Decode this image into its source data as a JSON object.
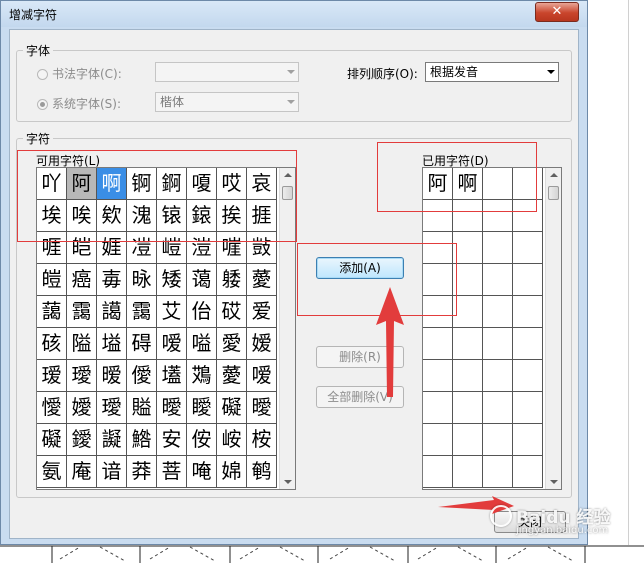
{
  "dialog": {
    "title": "增减字符",
    "close_label": "✕"
  },
  "font_group": {
    "label": "字体",
    "calligraphy_radio": "书法字体(C):",
    "system_radio": "系统字体(S):",
    "calligraphy_value": "",
    "system_value": "楷体",
    "sort_label": "排列顺序(O):",
    "sort_value": "根据发音"
  },
  "char_group": {
    "label": "字符",
    "available_label": "可用字符(L)",
    "used_label": "已用字符(D)",
    "available_chars": [
      [
        "吖",
        "阿",
        "啊",
        "锕",
        "錒",
        "嗄",
        "哎",
        "哀"
      ],
      [
        "埃",
        "唉",
        "欸",
        "溾",
        "锿",
        "鎄",
        "挨",
        "捱"
      ],
      [
        "啀",
        "皑",
        "娾",
        "凒",
        "嵦",
        "溰",
        "嘊",
        "敱"
      ],
      [
        "皚",
        "癌",
        "毐",
        "昹",
        "矮",
        "蔼",
        "躷",
        "薆"
      ],
      [
        "藹",
        "靄",
        "譪",
        "靄",
        "艾",
        "佁",
        "砹",
        "爱"
      ],
      [
        "硋",
        "隘",
        "塧",
        "碍",
        "嗳",
        "嗌",
        "愛",
        "嫒"
      ],
      [
        "瑷",
        "璦",
        "暧",
        "僾",
        "壒",
        "鴱",
        "薆",
        "嗳"
      ],
      [
        "懓",
        "嬡",
        "璦",
        "賹",
        "曖",
        "瞹",
        "礙",
        "曖"
      ],
      [
        "礙",
        "鑀",
        "譺",
        "鯦",
        "安",
        "侒",
        "峖",
        "桉"
      ],
      [
        "氨",
        "庵",
        "谙",
        "莽",
        "菩",
        "唵",
        "婂",
        "鹌"
      ]
    ],
    "selected_gray": [
      0,
      1
    ],
    "selected_blue": [
      0,
      2
    ],
    "used_chars": [
      "阿",
      "啊"
    ],
    "add_button": "添加(A)",
    "delete_button": "删除(R)",
    "delete_all_button": "全部删除(V)"
  },
  "footer": {
    "close_button": "关闭"
  },
  "watermark": {
    "brand": "Baidu 经验",
    "url": "jingyan.baidu.com"
  },
  "colors": {
    "annotation": "#e23c3c",
    "selection_blue": "#3a8ee6",
    "selection_gray": "#b8b8b8"
  }
}
